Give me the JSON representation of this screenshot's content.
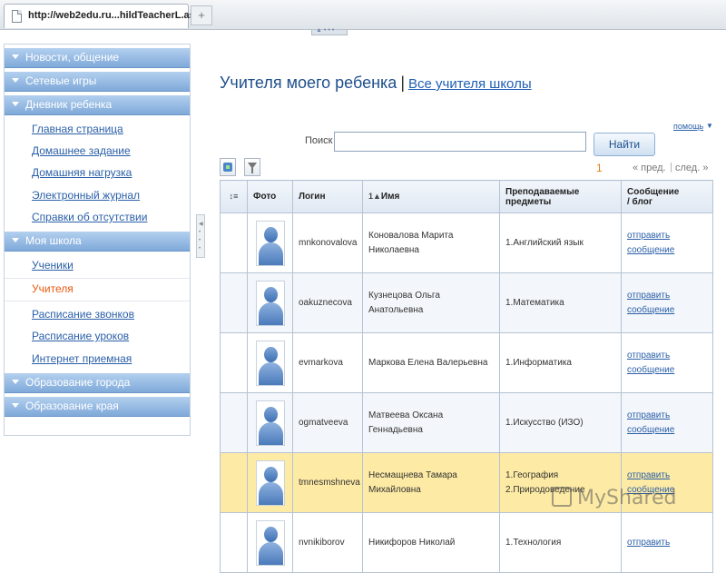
{
  "browser": {
    "tab_title": "http://web2edu.ru...hildTeacherL.aspx",
    "new_tab_label": "+"
  },
  "sidebar": {
    "sections": [
      {
        "label": "Новости, общение"
      },
      {
        "label": "Сетевые игры"
      },
      {
        "label": "Дневник ребенка"
      },
      {
        "label": "Моя школа"
      },
      {
        "label": "Образование города"
      },
      {
        "label": "Образование края"
      }
    ],
    "diary_items": [
      "Главная страница",
      "Домашнее задание",
      "Домашняя нагрузка",
      "Электронный журнал",
      "Справки об отсутствии"
    ],
    "school_items": [
      "Ученики",
      "Учителя",
      "Расписание звонков",
      "Расписание уроков",
      "Интернет приемная"
    ],
    "active_item": "Учителя"
  },
  "main": {
    "title": "Учителя моего ребенка",
    "separator": "|",
    "all_teachers_link": "Все учителя школы",
    "help_link": "помощь",
    "search_label": "Поиск",
    "search_value": "",
    "search_button": "Найти",
    "pager": {
      "current": "1",
      "prev": "« пред.",
      "sep": "|",
      "next": "след. »"
    }
  },
  "table": {
    "headers": {
      "photo": "Фото",
      "login": "Логин",
      "name": "Имя",
      "subjects_1": "Преподаваемые",
      "subjects_2": "предметы",
      "message_1": "Сообщение",
      "message_2": "/ блог"
    },
    "send_1": "отправить",
    "send_2": "сообщение",
    "rows": [
      {
        "login": "mnkonovalova",
        "name_1": "Коновалова Марита",
        "name_2": "Николаевна",
        "subject_1": "1.Английский язык",
        "subject_2": ""
      },
      {
        "login": "oakuznecova",
        "name_1": "Кузнецова Ольга Анатольевна",
        "name_2": "",
        "subject_1": "1.Математика",
        "subject_2": ""
      },
      {
        "login": "evmarkova",
        "name_1": "Маркова Елена Валерьевна",
        "name_2": "",
        "subject_1": "1.Информатика",
        "subject_2": ""
      },
      {
        "login": "ogmatveeva",
        "name_1": "Матвеева Оксана Геннадьевна",
        "name_2": "",
        "subject_1": "1.Искусство (ИЗО)",
        "subject_2": ""
      },
      {
        "login": "tmnesmshneva",
        "name_1": "Несмащнева Тамара",
        "name_2": "Михайловна",
        "subject_1": "1.География",
        "subject_2": "2.Природоведение"
      },
      {
        "login": "nvnikiborov",
        "name_1": "Никифоров Николай",
        "name_2": "",
        "subject_1": "1.Технология",
        "subject_2": ""
      }
    ]
  },
  "watermark": {
    "text": "MyShared"
  }
}
